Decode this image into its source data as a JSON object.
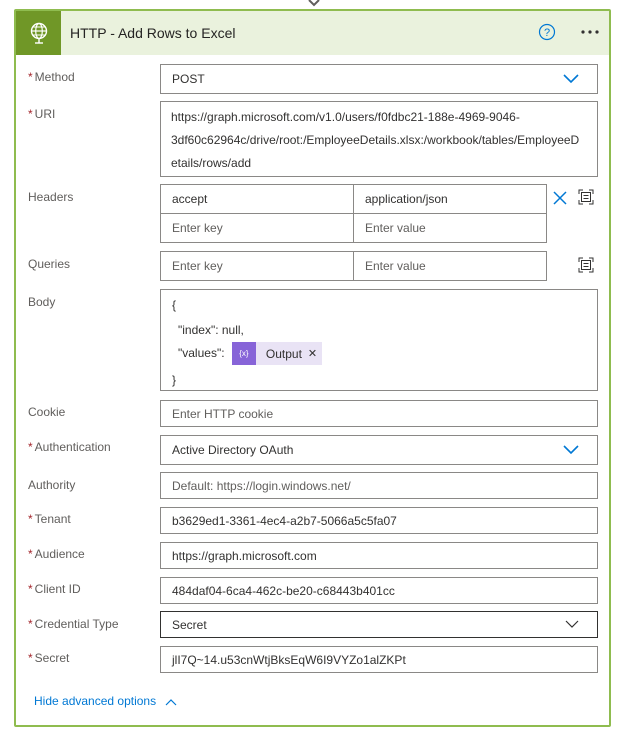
{
  "card": {
    "title": "HTTP - Add Rows to Excel",
    "accent_color": "#709727",
    "header_bg": "#eaf2dd",
    "icons": {
      "app": "globe-icon",
      "help": "help-circle-icon",
      "menu": "more-horizontal-icon"
    }
  },
  "fields": {
    "method": {
      "label": "Method",
      "required": "*",
      "value": "POST"
    },
    "uri": {
      "label": "URI",
      "required": "*",
      "lines": [
        "https://graph.microsoft.com/v1.0/users/f0fdbc21-188e-4969-9046-",
        "3df60c62964c/drive/root:/EmployeeDetails.xlsx:/workbook/tables/EmployeeD",
        "etails/rows/add"
      ]
    },
    "headers": {
      "label": "Headers",
      "rows": [
        {
          "key": "accept",
          "value": "application/json"
        }
      ],
      "key_placeholder": "Enter key",
      "value_placeholder": "Enter value"
    },
    "queries": {
      "label": "Queries",
      "key_placeholder": "Enter key",
      "value_placeholder": "Enter value"
    },
    "body": {
      "label": "Body",
      "line1": "{",
      "line2": "\"index\": null,",
      "line3_prefix": "\"values\":",
      "token_label": "Output",
      "token_icon": "{x}",
      "line4": "}"
    },
    "cookie": {
      "label": "Cookie",
      "placeholder": "Enter HTTP cookie"
    },
    "authentication": {
      "label": "Authentication",
      "required": "*",
      "value": "Active Directory OAuth"
    },
    "authority": {
      "label": "Authority",
      "placeholder": "Default: https://login.windows.net/"
    },
    "tenant": {
      "label": "Tenant",
      "required": "*",
      "value": "b3629ed1-3361-4ec4-a2b7-5066a5c5fa07"
    },
    "audience": {
      "label": "Audience",
      "required": "*",
      "value": "https://graph.microsoft.com"
    },
    "client_id": {
      "label": "Client ID",
      "required": "*",
      "value": "484daf04-6ca4-462c-be20-c68443b401cc"
    },
    "credential_type": {
      "label": "Credential Type",
      "required": "*",
      "value": "Secret"
    },
    "secret": {
      "label": "Secret",
      "required": "*",
      "value": "jlI7Q~14.u53cnWtjBksEqW6I9VYZo1alZKPt"
    }
  },
  "advanced_toggle": {
    "label": "Hide advanced options"
  },
  "colors": {
    "link": "#0078d4",
    "required": "#a4262c",
    "token": "#8764d8",
    "token_bg": "#e9e3f5"
  }
}
